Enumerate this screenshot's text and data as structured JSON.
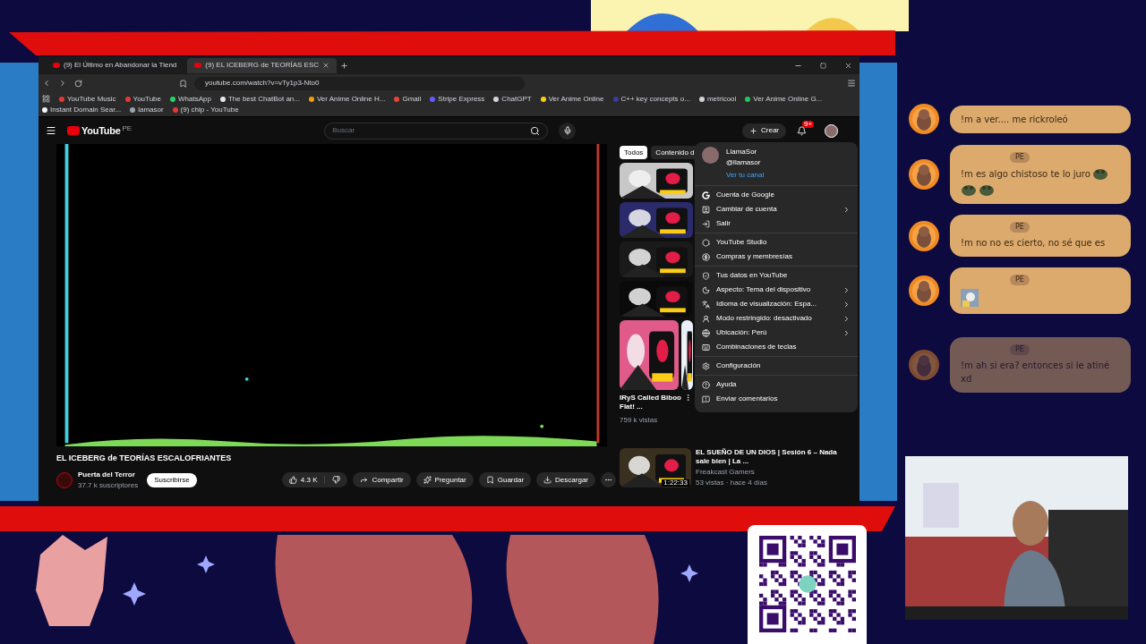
{
  "browser": {
    "tabs": [
      {
        "title": "(9) El Último en Abandonar la Tiend",
        "selected": false
      },
      {
        "title": "(9) EL ICEBERG de TEORÍAS ESC",
        "selected": true
      }
    ],
    "url": "youtube.com/watch?v=vTy1p3-Nto0",
    "bookmarks": [
      {
        "label": "YouTube Music",
        "color": "#e53935"
      },
      {
        "label": "YouTube",
        "color": "#e53935"
      },
      {
        "label": "WhatsApp",
        "color": "#25d366"
      },
      {
        "label": "The best ChatBot an...",
        "color": "#e5e7eb"
      },
      {
        "label": "Ver Anime Online H...",
        "color": "#f59e0b"
      },
      {
        "label": "Gmail",
        "color": "#ea4335"
      },
      {
        "label": "Stripe Express",
        "color": "#635bff"
      },
      {
        "label": "ChatGPT",
        "color": "#d1d5db"
      },
      {
        "label": "Ver Anime Online",
        "color": "#facc15"
      },
      {
        "label": "C++ key concepts o...",
        "color": "#3b3b9e"
      },
      {
        "label": "metricool",
        "color": "#d1d5db"
      },
      {
        "label": "Ver Anime Online G...",
        "color": "#22c55e"
      },
      {
        "label": "Instant Domain Sear...",
        "color": "#f3f4f6"
      },
      {
        "label": "lamasor",
        "color": "#9ca3af"
      },
      {
        "label": "(9) chip - YouTube",
        "color": "#e53935"
      }
    ]
  },
  "youtube": {
    "logo": "YouTube",
    "country": "PE",
    "search_placeholder": "Buscar",
    "create": "Crear",
    "notifications": "9+",
    "video": {
      "title": "EL ICEBERG de TEORÍAS ESCALOFRIANTES",
      "channel": "Puerta del Terror",
      "subscribers": "37.7 k suscriptores",
      "subscribe": "Suscribirse",
      "likes": "4.3 K",
      "actions": [
        "Compartir",
        "Preguntar",
        "Guardar",
        "Descargar"
      ]
    },
    "filters": [
      {
        "label": "Todos",
        "selected": true
      },
      {
        "label": "Contenido d",
        "selected": false
      }
    ],
    "recommended": {
      "title": "IRyS Called Biboo Flat! ...",
      "views": "759 k vistas"
    },
    "next": {
      "title": "EL SUEÑO DE UN DIOS | Sesión 6 – Nada sale bien | La ...",
      "channel": "Freakcast Gamers",
      "meta": "53 vistas · hace 4 días",
      "duration": "1:22:33"
    },
    "account_menu": {
      "name": "LlamaSor",
      "handle": "@llamasor",
      "channel_link": "Ver tu canal",
      "groups": [
        [
          {
            "label": "Cuenta de Google",
            "submenu": false
          },
          {
            "label": "Cambiar de cuenta",
            "submenu": true
          },
          {
            "label": "Salir",
            "submenu": false
          }
        ],
        [
          {
            "label": "YouTube Studio",
            "submenu": false
          },
          {
            "label": "Compras y membresías",
            "submenu": false
          }
        ],
        [
          {
            "label": "Tus datos en YouTube",
            "submenu": false
          },
          {
            "label": "Aspecto: Tema del dispositivo",
            "submenu": true
          },
          {
            "label": "Idioma de visualización: Espa...",
            "submenu": true
          },
          {
            "label": "Modo restringido: desactivado",
            "submenu": true
          },
          {
            "label": "Ubicación: Perú",
            "submenu": true
          },
          {
            "label": "Combinaciones de teclas",
            "submenu": false
          }
        ],
        [
          {
            "label": "Configuración",
            "submenu": false
          }
        ],
        [
          {
            "label": "Ayuda",
            "submenu": false
          },
          {
            "label": "Enviar comentarios",
            "submenu": false
          }
        ]
      ]
    }
  },
  "chat": [
    {
      "kind": "text",
      "text": "!m a ver.... me rickroleó",
      "faded": false
    },
    {
      "kind": "emotes",
      "badge": "PE",
      "text": "!m es algo chistoso te lo juro",
      "faded": false
    },
    {
      "kind": "text",
      "badge": "PE",
      "text": "!m no no es cierto, no sé que es",
      "faded": false
    },
    {
      "badge": "PE",
      "faded": false
    },
    {
      "kind": "text",
      "badge": "PE",
      "text": "!m ah si era? entonces si le atiné xd",
      "faded": true
    }
  ]
}
